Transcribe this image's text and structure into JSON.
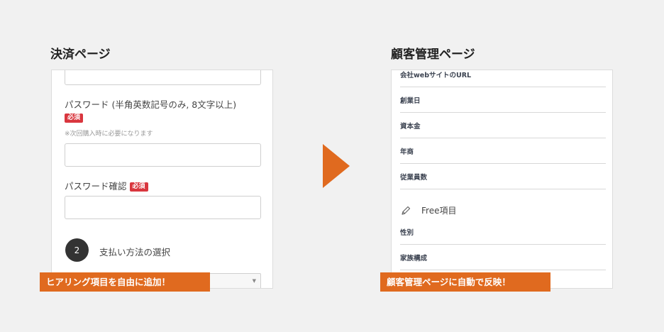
{
  "left": {
    "heading": "決済ページ",
    "password_label": "パスワード (半角英数記号のみ, 8文字以上)",
    "required_badge": "必須",
    "note": "※次回購入時に必要になります",
    "confirm_label": "パスワード確認",
    "step_number": "2",
    "step_label": "支払い方法の選択",
    "caption": "ヒアリング項目を自由に追加！"
  },
  "right": {
    "heading": "顧客管理ページ",
    "fields": [
      "会社webサイトのURL",
      "創業日",
      "資本金",
      "年商",
      "従業員数"
    ],
    "free_section_title": "Free項目",
    "free_fields": [
      "性別",
      "家族構成"
    ],
    "caption": "顧客管理ページに自動で反映！"
  },
  "colors": {
    "accent": "#e06a1f",
    "badge": "#d9363e"
  },
  "icons": {
    "arrow": "arrow-right-icon",
    "pencil": "pencil-icon"
  }
}
